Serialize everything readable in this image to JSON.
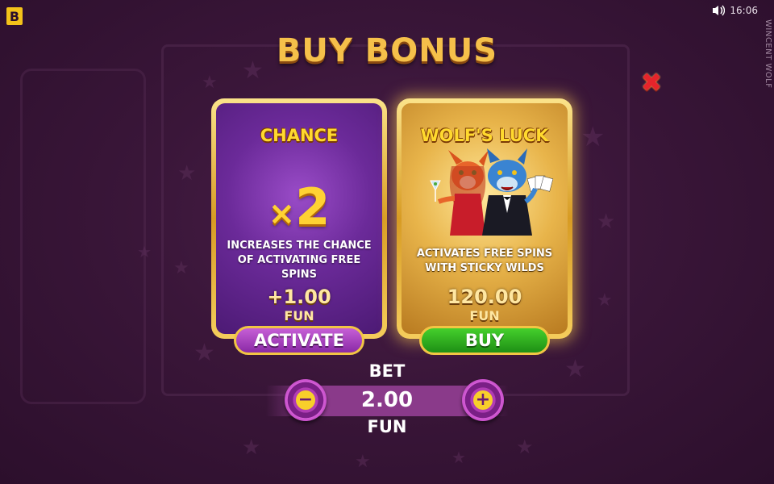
{
  "brand": {
    "logo_letter": "B",
    "accent": "#f3c21a"
  },
  "status": {
    "time": "16:06",
    "sound_icon": "speaker-icon"
  },
  "game_name": "WINCENT WOLF",
  "title": "BUY BONUS",
  "close_icon": "close-x-icon",
  "cards": {
    "chance": {
      "title": "CHANCE",
      "multiplier_prefix": "×",
      "multiplier_value": "2",
      "description": "INCREASES THE CHANCE OF ACTIVATING FREE SPINS",
      "price": "+1.00",
      "currency": "FUN",
      "button": "ACTIVATE"
    },
    "wolfs_luck": {
      "title": "WOLF'S LUCK",
      "description": "ACTIVATES FREE SPINS WITH STICKY WILDS",
      "price": "120.00",
      "currency": "FUN",
      "button": "BUY"
    }
  },
  "bet": {
    "label": "BET",
    "value": "2.00",
    "currency": "FUN",
    "minus": "−",
    "plus": "+"
  },
  "colors": {
    "background": "#3a1639",
    "title": "#f5c04a",
    "activate": "#a63fbf",
    "buy": "#2fb320",
    "close": "#e5242b"
  }
}
